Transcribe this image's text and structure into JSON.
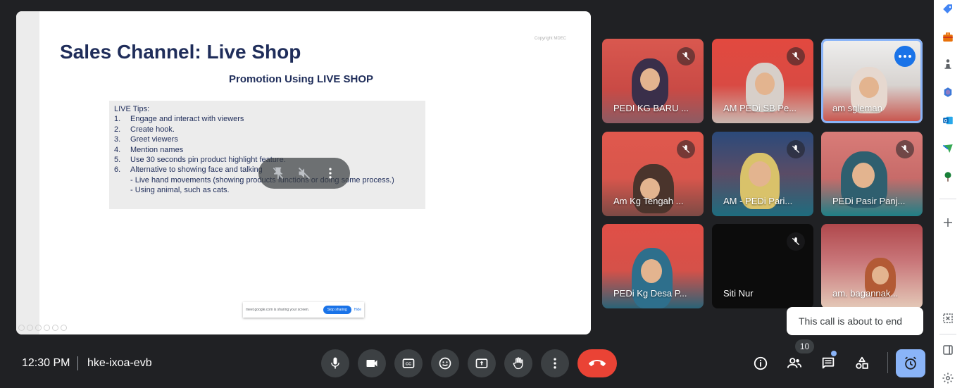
{
  "presentation": {
    "copyright": "Copyright MDEC",
    "title": "Sales Channel: Live Shop",
    "subtitle": "Promotion Using LIVE SHOP",
    "tips_heading": "LIVE Tips:",
    "tips": [
      {
        "num": "1.",
        "text": "Engage and interact with viewers"
      },
      {
        "num": "2.",
        "text": "Create hook."
      },
      {
        "num": "3.",
        "text": "Greet viewers"
      },
      {
        "num": "4.",
        "text": "Mention names"
      },
      {
        "num": "5.",
        "text": "Use 30 seconds pin product highlight feature."
      },
      {
        "num": "6.",
        "text": "Alternative to showing face and talking"
      }
    ],
    "sub_tips": [
      "- Live hand movements (showing products functions or doing some process.)",
      "- Using animal, such as cats."
    ],
    "share_bar": {
      "text": "meet.google.com is sharing your screen.",
      "stop_label": "Stop sharing",
      "hide_label": "Hide"
    }
  },
  "participants": [
    {
      "name": "PEDI KG BARU ...",
      "muted": true
    },
    {
      "name": "AM PEDi SB Pe...",
      "muted": true
    },
    {
      "name": "am sgleman",
      "muted": false,
      "active": true
    },
    {
      "name": "Am Kg Tengah ...",
      "muted": true
    },
    {
      "name": "AM - PEDi Pari...",
      "muted": true
    },
    {
      "name": "PEDi Pasir Panj...",
      "muted": true
    },
    {
      "name": "PEDi Kg Desa P...",
      "muted": false
    },
    {
      "name": "Siti Nur",
      "muted": true
    },
    {
      "name": "am. bagannak...",
      "muted": false
    }
  ],
  "toast": {
    "message": "This call is about to end"
  },
  "bottom_bar": {
    "time": "12:30 PM",
    "meeting_code": "hke-ixoa-evb",
    "participant_count": "10"
  },
  "colors": {
    "background": "#202124",
    "end_call": "#ea4335",
    "accent": "#8ab4f8",
    "slide_text": "#1f2d5a"
  }
}
